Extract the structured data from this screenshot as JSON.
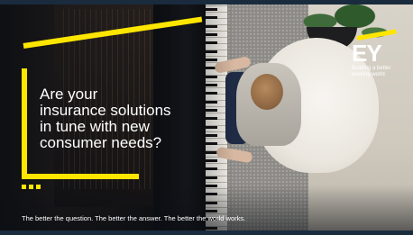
{
  "headline": {
    "lines": [
      "Are your",
      "insurance solutions",
      "in tune with new",
      "consumer needs?"
    ]
  },
  "tagline": "The better the question. The better the answer. The better the world works.",
  "logo": {
    "mark": "EY",
    "sub_lines": [
      "Building a better",
      "working world"
    ]
  },
  "colors": {
    "accent_yellow": "#ffe600",
    "text": "#ffffff",
    "frame_navy": "#1a2b3d"
  },
  "icons": [
    "ey-logo",
    "yellow-beam-frame",
    "dots-ellipsis"
  ]
}
